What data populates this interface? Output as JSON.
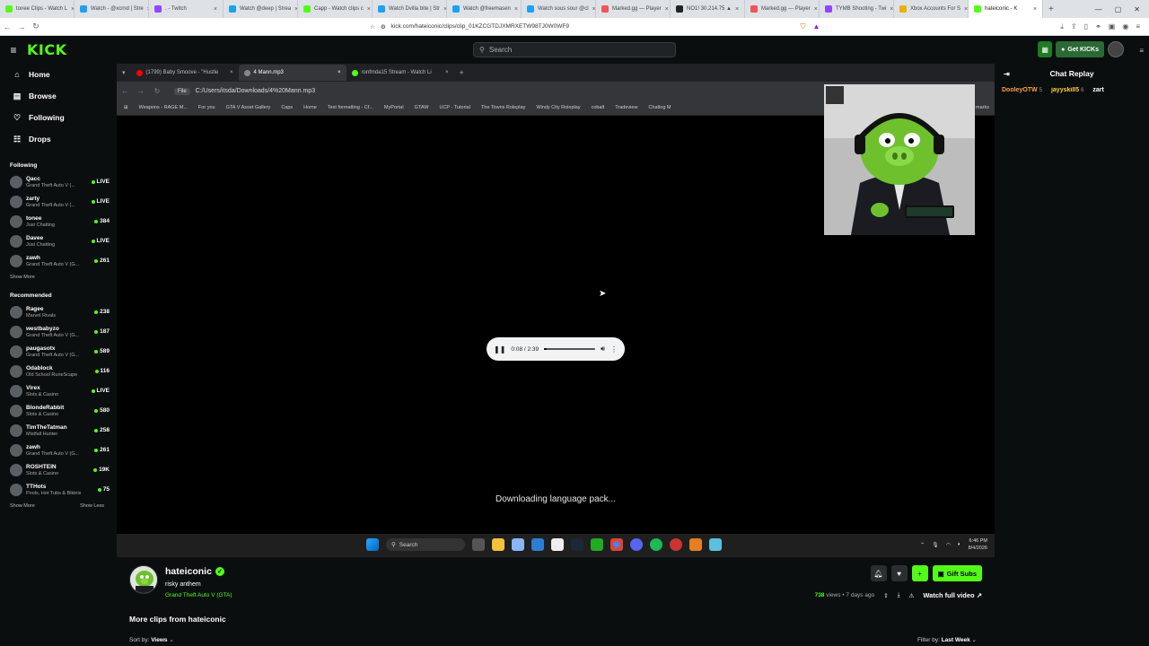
{
  "browser": {
    "tabs": [
      {
        "label": "tonee Clips - Watch L",
        "color": "#53fc18"
      },
      {
        "label": "Watch - @xcrnd | Stre",
        "color": "#1da1f2"
      },
      {
        "label": ". - Twitch",
        "color": "#9146ff"
      },
      {
        "label": "Watch @deep | Strea",
        "color": "#1da1f2"
      },
      {
        "label": "Capp - Watch clips c",
        "color": "#53fc18"
      },
      {
        "label": "Watch Dvilla bite | Str",
        "color": "#1da1f2"
      },
      {
        "label": "Watch @freemasen",
        "color": "#1da1f2"
      },
      {
        "label": "Watch sous sour @cl",
        "color": "#1da1f2"
      },
      {
        "label": "Marked.gg — Player",
        "color": "#e55"
      },
      {
        "label": "NO1! 30.214.75 ▲",
        "color": "#222"
      },
      {
        "label": "Marked.gg — Player",
        "color": "#e55"
      },
      {
        "label": "TYMB Shooting - Twi",
        "color": "#9146ff"
      },
      {
        "label": "Xbox Accounts For S",
        "color": "#e5b400"
      },
      {
        "label": "hateiconic - K",
        "color": "#53fc18"
      }
    ],
    "url": "kick.com/hateiconic/clips/clip_01KZCGTDJXMRXETW98TJ0W0WF9"
  },
  "header": {
    "logo": "KICK",
    "search_placeholder": "Search",
    "get_kicks": "Get KICKs"
  },
  "sidebar": {
    "nav": [
      {
        "label": "Home",
        "icon": "home-icon",
        "glyph": "⌂"
      },
      {
        "label": "Browse",
        "icon": "browse-icon",
        "glyph": "▤"
      },
      {
        "label": "Following",
        "icon": "heart-icon",
        "glyph": "♡"
      },
      {
        "label": "Drops",
        "icon": "drops-icon",
        "glyph": "☷"
      }
    ],
    "following_title": "Following",
    "following": [
      {
        "name": "Qacc",
        "game": "Grand Theft Auto V (...",
        "viewers": "LIVE"
      },
      {
        "name": "zarty",
        "game": "Grand Theft Auto V (...",
        "viewers": "LIVE"
      },
      {
        "name": "tonee",
        "game": "Just Chatting",
        "viewers": "384"
      },
      {
        "name": "Davee",
        "game": "Just Chatting",
        "viewers": "LIVE"
      },
      {
        "name": "zawh",
        "game": "Grand Theft Auto V (G...",
        "viewers": "261"
      }
    ],
    "show_more": "Show More",
    "recommended_title": "Recommended",
    "recommended": [
      {
        "name": "Ragee",
        "game": "Marvel Rivals",
        "viewers": "238"
      },
      {
        "name": "westbabyzo",
        "game": "Grand Theft Auto V (G...",
        "viewers": "187"
      },
      {
        "name": "paugasotx",
        "game": "Grand Theft Auto V (G...",
        "viewers": "589"
      },
      {
        "name": "Odablock",
        "game": "Old School RuneScape",
        "viewers": "116"
      },
      {
        "name": "Virex",
        "game": "Slots & Casino",
        "viewers": "LIVE"
      },
      {
        "name": "BlondeRabbit",
        "game": "Slots & Casino",
        "viewers": "580"
      },
      {
        "name": "TimTheTatman",
        "game": "Mistfall Hunter",
        "viewers": "258"
      },
      {
        "name": "zawh",
        "game": "Grand Theft Auto V (G...",
        "viewers": "261"
      },
      {
        "name": "ROSHTEIN",
        "game": "Slots & Casino",
        "viewers": "19K"
      },
      {
        "name": "TTHots",
        "game": "Pools, Hot Tubs & Bikinis",
        "viewers": "75"
      }
    ],
    "show_more_2": "Show More",
    "show_less": "Show Less"
  },
  "player": {
    "inner_tabs": [
      {
        "label": "(1799) Baby Smoove - \"Hustle",
        "color": "#f00"
      },
      {
        "label": "4 Mann.mp3",
        "color": "#888"
      },
      {
        "label": "ronfmda15 Stream - Watch Li",
        "color": "#53fc18"
      }
    ],
    "file_label": "File",
    "file_path": "C:/Users/itsda/Downloads/4%20Mann.mp3",
    "bookmarks": [
      "Weapons - RAGE M...",
      "For you",
      "GTA V Asset Gallery",
      "Caps",
      "Home",
      "Text formatting - Cf...",
      "MyPortal",
      "GTAW",
      "UCP - Tutorial",
      "The Towns Roleplay",
      "Windy City Roleplay",
      "cobalt",
      "Tradeview",
      "Chatlog M"
    ],
    "bookmarks_end": "marks",
    "audio_time": "0:08 / 2:39",
    "audio_progress": 0.05,
    "downloading": "Downloading language pack...",
    "taskbar_search": "Search",
    "clock_time": "6:46 PM",
    "clock_date": "8/4/2026"
  },
  "chat": {
    "title": "Chat Replay",
    "users": [
      {
        "name": "DooleyOTW",
        "count": "5",
        "color": "#ff9f43"
      },
      {
        "name": "jayyskill5",
        "count": "6",
        "color": "#ffcf3f"
      },
      {
        "name": "zart",
        "count": "",
        "color": "#ffffff"
      }
    ]
  },
  "clip": {
    "channel": "hateiconic",
    "title": "risky anthem",
    "game": "Grand Theft Auto V (GTA)",
    "gift_subs": "Gift Subs",
    "views": "738",
    "views_label": "views",
    "age": "• 7 days ago",
    "watch_full": "Watch full video",
    "more_clips": "More clips from hateiconic",
    "sort_label": "Sort by:",
    "sort_value": "Views",
    "filter_label": "Filter by:",
    "filter_value": "Last Week"
  }
}
